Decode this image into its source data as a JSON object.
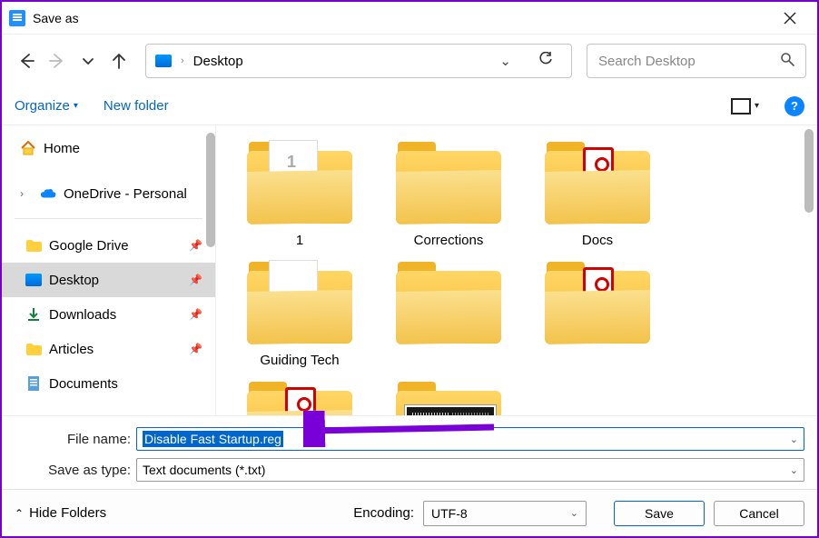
{
  "title": "Save as",
  "breadcrumb": {
    "location": "Desktop"
  },
  "search": {
    "placeholder": "Search Desktop"
  },
  "toolbar": {
    "organize": "Organize",
    "new_folder": "New folder"
  },
  "navtree": {
    "home": "Home",
    "onedrive": "OneDrive - Personal",
    "quick": [
      {
        "label": "Google Drive"
      },
      {
        "label": "Desktop"
      },
      {
        "label": "Downloads"
      },
      {
        "label": "Articles"
      },
      {
        "label": "Documents"
      }
    ]
  },
  "items": [
    {
      "label": "1",
      "kind": "num"
    },
    {
      "label": "Corrections",
      "kind": "plain"
    },
    {
      "label": "Docs",
      "kind": "pdf"
    },
    {
      "label": "Guiding Tech",
      "kind": "plain"
    },
    {
      "label": "",
      "kind": "plain"
    },
    {
      "label": "",
      "kind": "pdf"
    },
    {
      "label": "",
      "kind": "pdf"
    },
    {
      "label": "",
      "kind": "dark"
    }
  ],
  "form": {
    "file_name_label": "File name:",
    "file_name_value": "Disable Fast Startup.reg",
    "type_label": "Save as type:",
    "type_value": "Text documents (*.txt)"
  },
  "footer": {
    "hide": "Hide Folders",
    "encoding_label": "Encoding:",
    "encoding_value": "UTF-8",
    "save": "Save",
    "cancel": "Cancel"
  }
}
